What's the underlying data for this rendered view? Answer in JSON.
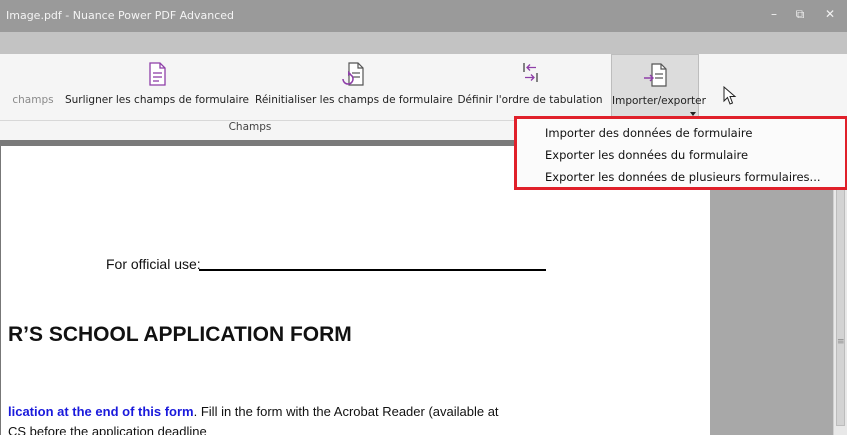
{
  "window": {
    "title": "Image.pdf - Nuance Power PDF Advanced",
    "minimize_glyph": "–",
    "restore_glyph": "⧉",
    "close_glyph": "✕"
  },
  "ribbon": {
    "partial_button_label": "champs",
    "buttons": [
      {
        "label": "Surligner les champs de formulaire",
        "icon": "highlight-fields-icon"
      },
      {
        "label": "Réinitialiser les champs de formulaire",
        "icon": "reset-fields-icon"
      },
      {
        "label": "Définir l'ordre de tabulation",
        "icon": "tab-order-icon"
      },
      {
        "label": "Importer/exporter",
        "icon": "import-export-icon"
      }
    ],
    "group_label": "Champs"
  },
  "dropdown_menu": {
    "items": [
      "Importer des données de formulaire",
      "Exporter les données du formulaire",
      "Exporter les données de plusieurs formulaires..."
    ]
  },
  "document": {
    "official_use_label": "For official use:",
    "heading": "R’S SCHOOL APPLICATION FORM",
    "paragraph_link": "lication at the end of this form",
    "paragraph_rest": ". Fill in the form with the Acrobat Reader (available at",
    "paragraph_line2": "CS before the application deadline"
  },
  "colors": {
    "highlight_border": "#e0202a",
    "icon_purple": "#8e3fa8",
    "link_blue": "#1a1adc"
  }
}
